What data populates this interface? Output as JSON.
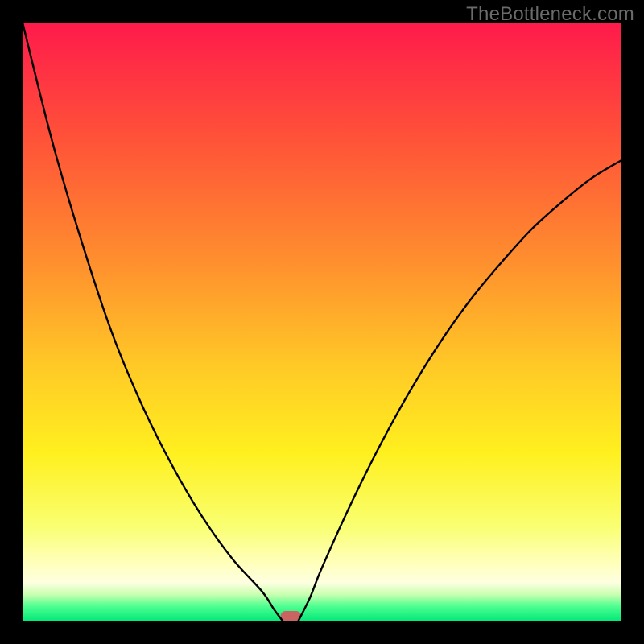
{
  "watermark": "TheBottleneck.com",
  "chart_data": {
    "type": "line",
    "title": "",
    "xlabel": "",
    "ylabel": "",
    "xlim": [
      0,
      100
    ],
    "ylim": [
      0,
      100
    ],
    "grid": false,
    "legend": false,
    "series": [
      {
        "name": "left-arm",
        "x": [
          0,
          5,
          10,
          15,
          20,
          25,
          30,
          35,
          40,
          42,
          43.5
        ],
        "values": [
          100,
          80,
          63,
          48,
          36,
          26,
          17.5,
          10.5,
          5,
          2,
          0
        ]
      },
      {
        "name": "right-arm",
        "x": [
          46,
          48,
          50,
          55,
          60,
          65,
          70,
          75,
          80,
          85,
          90,
          95,
          100
        ],
        "values": [
          0,
          4,
          9,
          20,
          30,
          39,
          47,
          54,
          60,
          65.5,
          70,
          74,
          77
        ]
      }
    ],
    "marker": {
      "name": "bottleneck-marker",
      "x": 44.8,
      "width": 3.4,
      "color": "#c96463"
    },
    "gradient_stops": [
      {
        "offset": 0.0,
        "color": "#ff1a4b"
      },
      {
        "offset": 0.2,
        "color": "#ff5438"
      },
      {
        "offset": 0.4,
        "color": "#ff8f2e"
      },
      {
        "offset": 0.58,
        "color": "#ffcb26"
      },
      {
        "offset": 0.72,
        "color": "#fff01f"
      },
      {
        "offset": 0.84,
        "color": "#f9ff70"
      },
      {
        "offset": 0.9,
        "color": "#ffffb8"
      },
      {
        "offset": 0.935,
        "color": "#feffe0"
      },
      {
        "offset": 0.955,
        "color": "#c9ffb0"
      },
      {
        "offset": 0.975,
        "color": "#4cff90"
      },
      {
        "offset": 1.0,
        "color": "#00e878"
      }
    ]
  }
}
